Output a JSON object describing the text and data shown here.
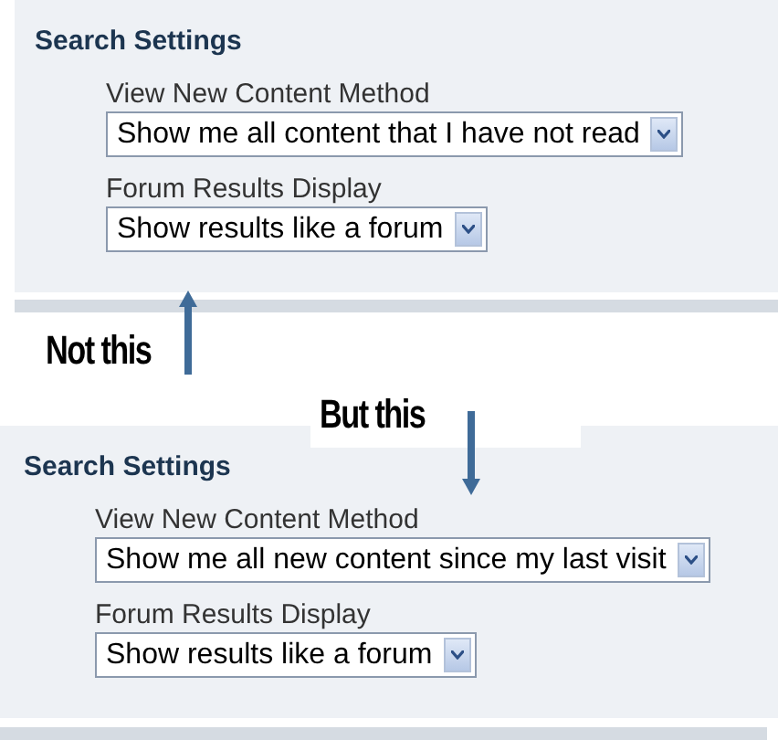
{
  "panels": [
    {
      "title": "Search Settings",
      "fields": [
        {
          "label": "View New Content Method",
          "value": "Show me all content that I have not read"
        },
        {
          "label": "Forum Results Display",
          "value": "Show results like a forum"
        }
      ]
    },
    {
      "title": "Search Settings",
      "fields": [
        {
          "label": "View New Content Method",
          "value": "Show me all new content since my last visit"
        },
        {
          "label": "Forum Results Display",
          "value": "Show results like a forum"
        }
      ]
    }
  ],
  "annotations": [
    {
      "text": "Not this",
      "kind": "up"
    },
    {
      "text": "But this",
      "kind": "down"
    }
  ]
}
